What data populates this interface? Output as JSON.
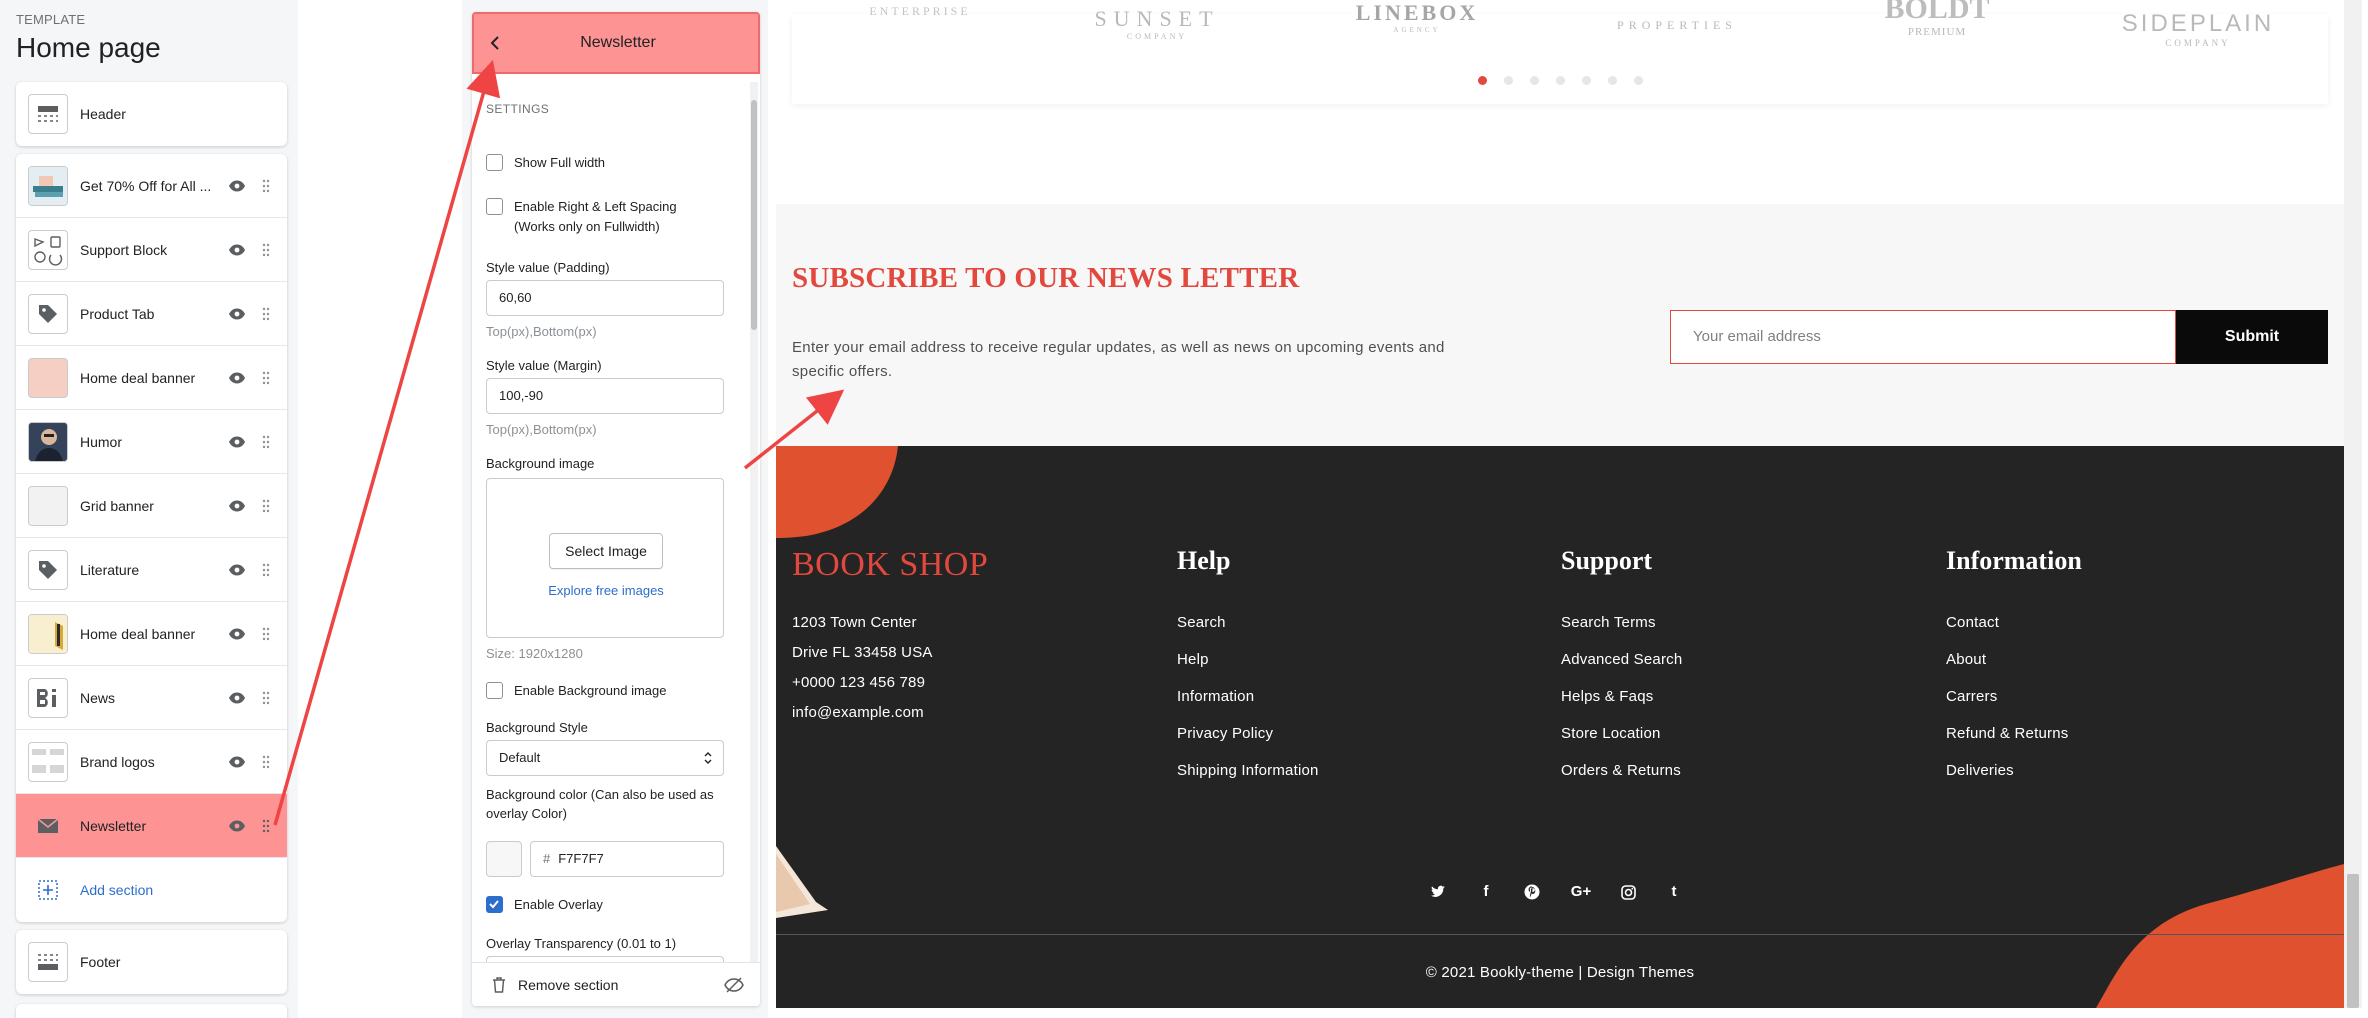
{
  "template": {
    "eyebrow": "TEMPLATE",
    "title": "Home page"
  },
  "sections": {
    "header": {
      "label": "Header",
      "icon": "header-layout-icon"
    },
    "items": [
      {
        "label": "Get 70% Off for All ...",
        "icon": "image-thumbnail"
      },
      {
        "label": "Support Block",
        "icon": "support-icons-thumbnail"
      },
      {
        "label": "Product Tab",
        "icon": "tag-icon"
      },
      {
        "label": "Home deal banner",
        "icon": "image-thumbnail"
      },
      {
        "label": "Humor",
        "icon": "portrait-thumbnail"
      },
      {
        "label": "Grid banner",
        "icon": "image-thumbnail"
      },
      {
        "label": "Literature",
        "icon": "tag-icon"
      },
      {
        "label": "Home deal banner",
        "icon": "image-thumbnail"
      },
      {
        "label": "News",
        "icon": "blog-icon"
      },
      {
        "label": "Brand logos",
        "icon": "logo-list-thumbnail"
      },
      {
        "label": "Newsletter",
        "icon": "mail-icon",
        "active": true
      }
    ],
    "add_section": "Add section",
    "footer": {
      "label": "Footer",
      "icon": "footer-layout-icon"
    }
  },
  "panel": {
    "title": "Newsletter",
    "settings_caps": "SETTINGS",
    "show_full_width": {
      "label": "Show Full width",
      "checked": false
    },
    "enable_spacing": {
      "label_line1": "Enable Right & Left Spacing",
      "label_line2": "(Works only on Fullwidth)",
      "checked": false
    },
    "padding": {
      "label": "Style value (Padding)",
      "value": "60,60",
      "help": "Top(px),Bottom(px)"
    },
    "margin": {
      "label": "Style value (Margin)",
      "value": "100,-90",
      "help": "Top(px),Bottom(px)"
    },
    "background_image": {
      "label": "Background image",
      "button": "Select Image",
      "explore": "Explore free images",
      "size": "Size: 1920x1280"
    },
    "enable_bg_image": {
      "label": "Enable Background image",
      "checked": false
    },
    "bg_style": {
      "label": "Background Style",
      "value": "Default"
    },
    "bg_color": {
      "label_line1": "Background color (Can also be used as",
      "label_line2": "overlay Color)",
      "hash": "#",
      "value": "F7F7F7"
    },
    "enable_overlay": {
      "label": "Enable Overlay",
      "checked": true
    },
    "overlay_transparency": {
      "label": "Overlay Transparency (0.01 to 1)"
    },
    "remove": "Remove section"
  },
  "preview": {
    "brands": [
      {
        "name": "ENTERPRISE",
        "sub": ""
      },
      {
        "name": "SUNSET",
        "sub": "COMPANY"
      },
      {
        "name": "LINEBOX",
        "sub": "AGENCY"
      },
      {
        "name": "PROPERTIES",
        "sub": ""
      },
      {
        "name": "BOLDT",
        "sub": "PREMIUM"
      },
      {
        "name": "SIDEPLAIN",
        "sub": "COMPANY"
      }
    ],
    "carousel": {
      "count": 7,
      "active": 0
    },
    "newsletter": {
      "title": "SUBSCRIBE TO OUR NEWS LETTER",
      "description": "Enter your email address to receive regular updates, as well as news on upcoming events and specific offers.",
      "placeholder": "Your email address",
      "submit": "Submit"
    },
    "footer": {
      "logo": "BOOK SHOP",
      "address": [
        "1203 Town Center",
        "Drive FL 33458 USA",
        "+0000 123 456 789",
        "info@example.com"
      ],
      "columns": [
        {
          "heading": "Help",
          "links": [
            "Search",
            "Help",
            "Information",
            "Privacy Policy",
            "Shipping Information"
          ]
        },
        {
          "heading": "Support",
          "links": [
            "Search Terms",
            "Advanced Search",
            "Helps & Faqs",
            "Store Location",
            "Orders & Returns"
          ]
        },
        {
          "heading": "Information",
          "links": [
            "Contact",
            "About",
            "Carrers",
            "Refund & Returns",
            "Deliveries"
          ]
        }
      ],
      "social": [
        "twitter-icon",
        "facebook-icon",
        "pinterest-icon",
        "google-plus-icon",
        "instagram-icon",
        "tumblr-icon"
      ],
      "copyright": "© 2021 Bookly-theme | Design Themes"
    }
  },
  "colors": {
    "accent": "#e2483d",
    "highlight": "#fe9393",
    "link": "#2c6ecb",
    "footer_bg": "#242424",
    "newsletter_bg": "#F7F7F7"
  }
}
